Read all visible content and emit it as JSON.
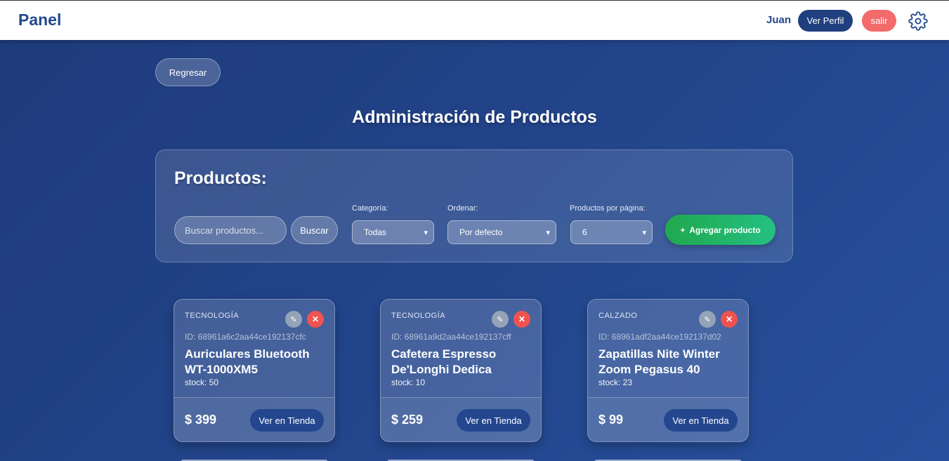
{
  "header": {
    "brand": "Panel",
    "username": "Juan",
    "profile_label": "Ver Perfil",
    "logout_label": "salir"
  },
  "back_label": "Regresar",
  "page_title": "Administración de Productos",
  "panel": {
    "title": "Productos:",
    "search_placeholder": "Buscar productos...",
    "search_button": "Buscar",
    "category_label": "Categoría:",
    "category_value": "Todas",
    "sort_label": "Ordenar:",
    "sort_value": "Por defecto",
    "per_page_label": "Productos por página:",
    "per_page_value": "6",
    "add_button": "Agregar producto",
    "add_icon": "+"
  },
  "products": [
    {
      "category": "TECNOLOGÍA",
      "id": "ID: 68961a6c2aa44ce192137cfc",
      "name": "Auriculares Bluetooth WT-1000XM5",
      "stock": "stock: 50",
      "price": "$ 399",
      "view_label": "Ver en Tienda"
    },
    {
      "category": "TECNOLOGÍA",
      "id": "ID: 68961a9d2aa44ce192137cff",
      "name": "Cafetera Espresso De'Longhi Dedica",
      "stock": "stock: 10",
      "price": "$ 259",
      "view_label": "Ver en Tienda"
    },
    {
      "category": "CALZADO",
      "id": "ID: 68961adf2aa44ce192137d02",
      "name": "Zapatillas Nite Winter Zoom Pegasus 40",
      "stock": "stock: 23",
      "price": "$ 99",
      "view_label": "Ver en Tienda"
    }
  ],
  "icons": {
    "edit": "✎",
    "delete": "✕",
    "chevron": "⌄"
  },
  "colors": {
    "brand": "#23498e",
    "logout": "#f26a6a",
    "add": "#1fa84e",
    "delete": "#ef5350"
  }
}
